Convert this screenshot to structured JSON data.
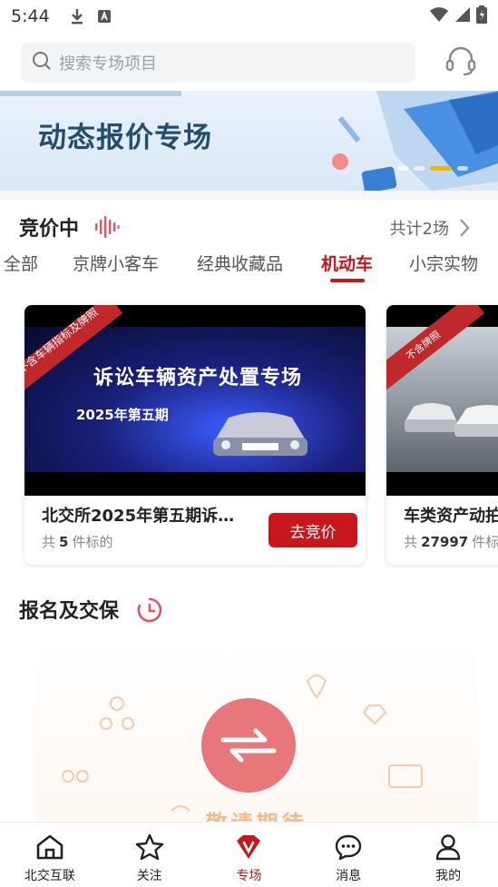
{
  "status_bar": {
    "time": "5:44"
  },
  "search": {
    "placeholder": "搜索专场项目"
  },
  "banner": {
    "title": "动态报价专场"
  },
  "bidding": {
    "title": "竞价中",
    "total": "共计2场",
    "tabs": [
      "全部",
      "京牌小客车",
      "经典收藏品",
      "机动车",
      "小宗实物"
    ],
    "active_tab": "机动车",
    "cards": [
      {
        "ribbon": "不含车辆指标及牌照",
        "image_title": "诉讼车辆资产处置专场",
        "image_subtitle": "2025年第五期",
        "title": "北交所2025年第五期诉…",
        "count_prefix": "共",
        "count": "5",
        "count_suffix": "件标的",
        "button": "去竞价"
      },
      {
        "ribbon": "不含牌照",
        "title": "车类资产动拍",
        "count_prefix": "共",
        "count": "27997",
        "count_suffix": "件标的"
      }
    ]
  },
  "signup": {
    "title": "报名及交保",
    "empty_text": "敬请期待"
  },
  "bottom_nav": {
    "items": [
      {
        "label": "北交互联",
        "icon": "home-icon"
      },
      {
        "label": "关注",
        "icon": "star-icon"
      },
      {
        "label": "专场",
        "icon": "v-logo-icon"
      },
      {
        "label": "消息",
        "icon": "message-icon"
      },
      {
        "label": "我的",
        "icon": "person-icon"
      }
    ],
    "active": "专场"
  },
  "colors": {
    "accent": "#c8161d",
    "banner_text": "#244e6f"
  }
}
